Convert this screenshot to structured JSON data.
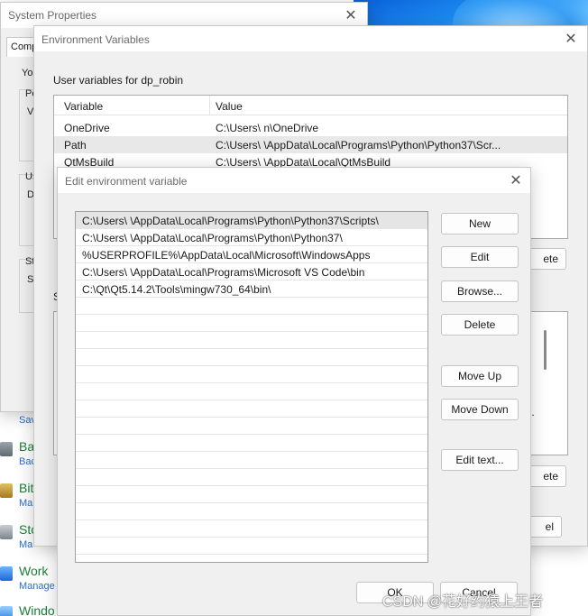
{
  "system_properties": {
    "title": "System Properties",
    "tab_fragment": "Comp",
    "fragments": [
      "Yo",
      "Pe",
      "Vi",
      "Us",
      "D",
      "St",
      "Sy",
      "S"
    ]
  },
  "control_panel": {
    "items": [
      {
        "title": "",
        "sub": "Sav",
        "icon": "save-icon"
      },
      {
        "title": "Ba",
        "sub": "Bac",
        "icon": "backup-icon"
      },
      {
        "title": "Bit",
        "sub": "Ma",
        "icon": "bitlocker-icon"
      },
      {
        "title": "Sto",
        "sub": "Ma",
        "icon": "storage-icon"
      },
      {
        "title": "Work",
        "sub": "Manage",
        "icon": "work-folders-icon"
      },
      {
        "title": "Windo",
        "sub": "",
        "icon": "windows-icon"
      }
    ]
  },
  "env_vars": {
    "title": "Environment Variables",
    "user_section_label": "User variables for dp_robin",
    "columns": [
      "Variable",
      "Value"
    ],
    "rows": [
      {
        "name": "OneDrive",
        "value": "C:\\Users\\        n\\OneDrive"
      },
      {
        "name": "Path",
        "value": "C:\\Users\\            \\AppData\\Local\\Programs\\Python\\Python37\\Scr..."
      },
      {
        "name": "QtMsBuild",
        "value": "C:\\Users\\              \\AppData\\Local\\QtMsBuild"
      }
    ],
    "user_delete_partial": "ete",
    "system_section_fragment": "S",
    "system_value_partial": "l...",
    "system_delete_partial": "ete",
    "cancel_partial": "el"
  },
  "edit_var": {
    "title": "Edit environment variable",
    "entries": [
      "C:\\Users\\             \\AppData\\Local\\Programs\\Python\\Python37\\Scripts\\",
      "C:\\Users\\             \\AppData\\Local\\Programs\\Python\\Python37\\",
      "%USERPROFILE%\\AppData\\Local\\Microsoft\\WindowsApps",
      "C:\\Users\\              \\AppData\\Local\\Programs\\Microsoft VS Code\\bin",
      "C:\\Qt\\Qt5.14.2\\Tools\\mingw730_64\\bin\\"
    ],
    "buttons": {
      "new": "New",
      "edit": "Edit",
      "browse": "Browse...",
      "delete": "Delete",
      "move_up": "Move Up",
      "move_down": "Move Down",
      "edit_text": "Edit text...",
      "ok": "OK",
      "cancel": "Cancel"
    }
  },
  "watermark": "CSDN @花好约猿上王者",
  "colors": {
    "accent_green": "#1a7f37",
    "link_blue": "#2a6fc9",
    "selection": "#e5e5e5"
  }
}
